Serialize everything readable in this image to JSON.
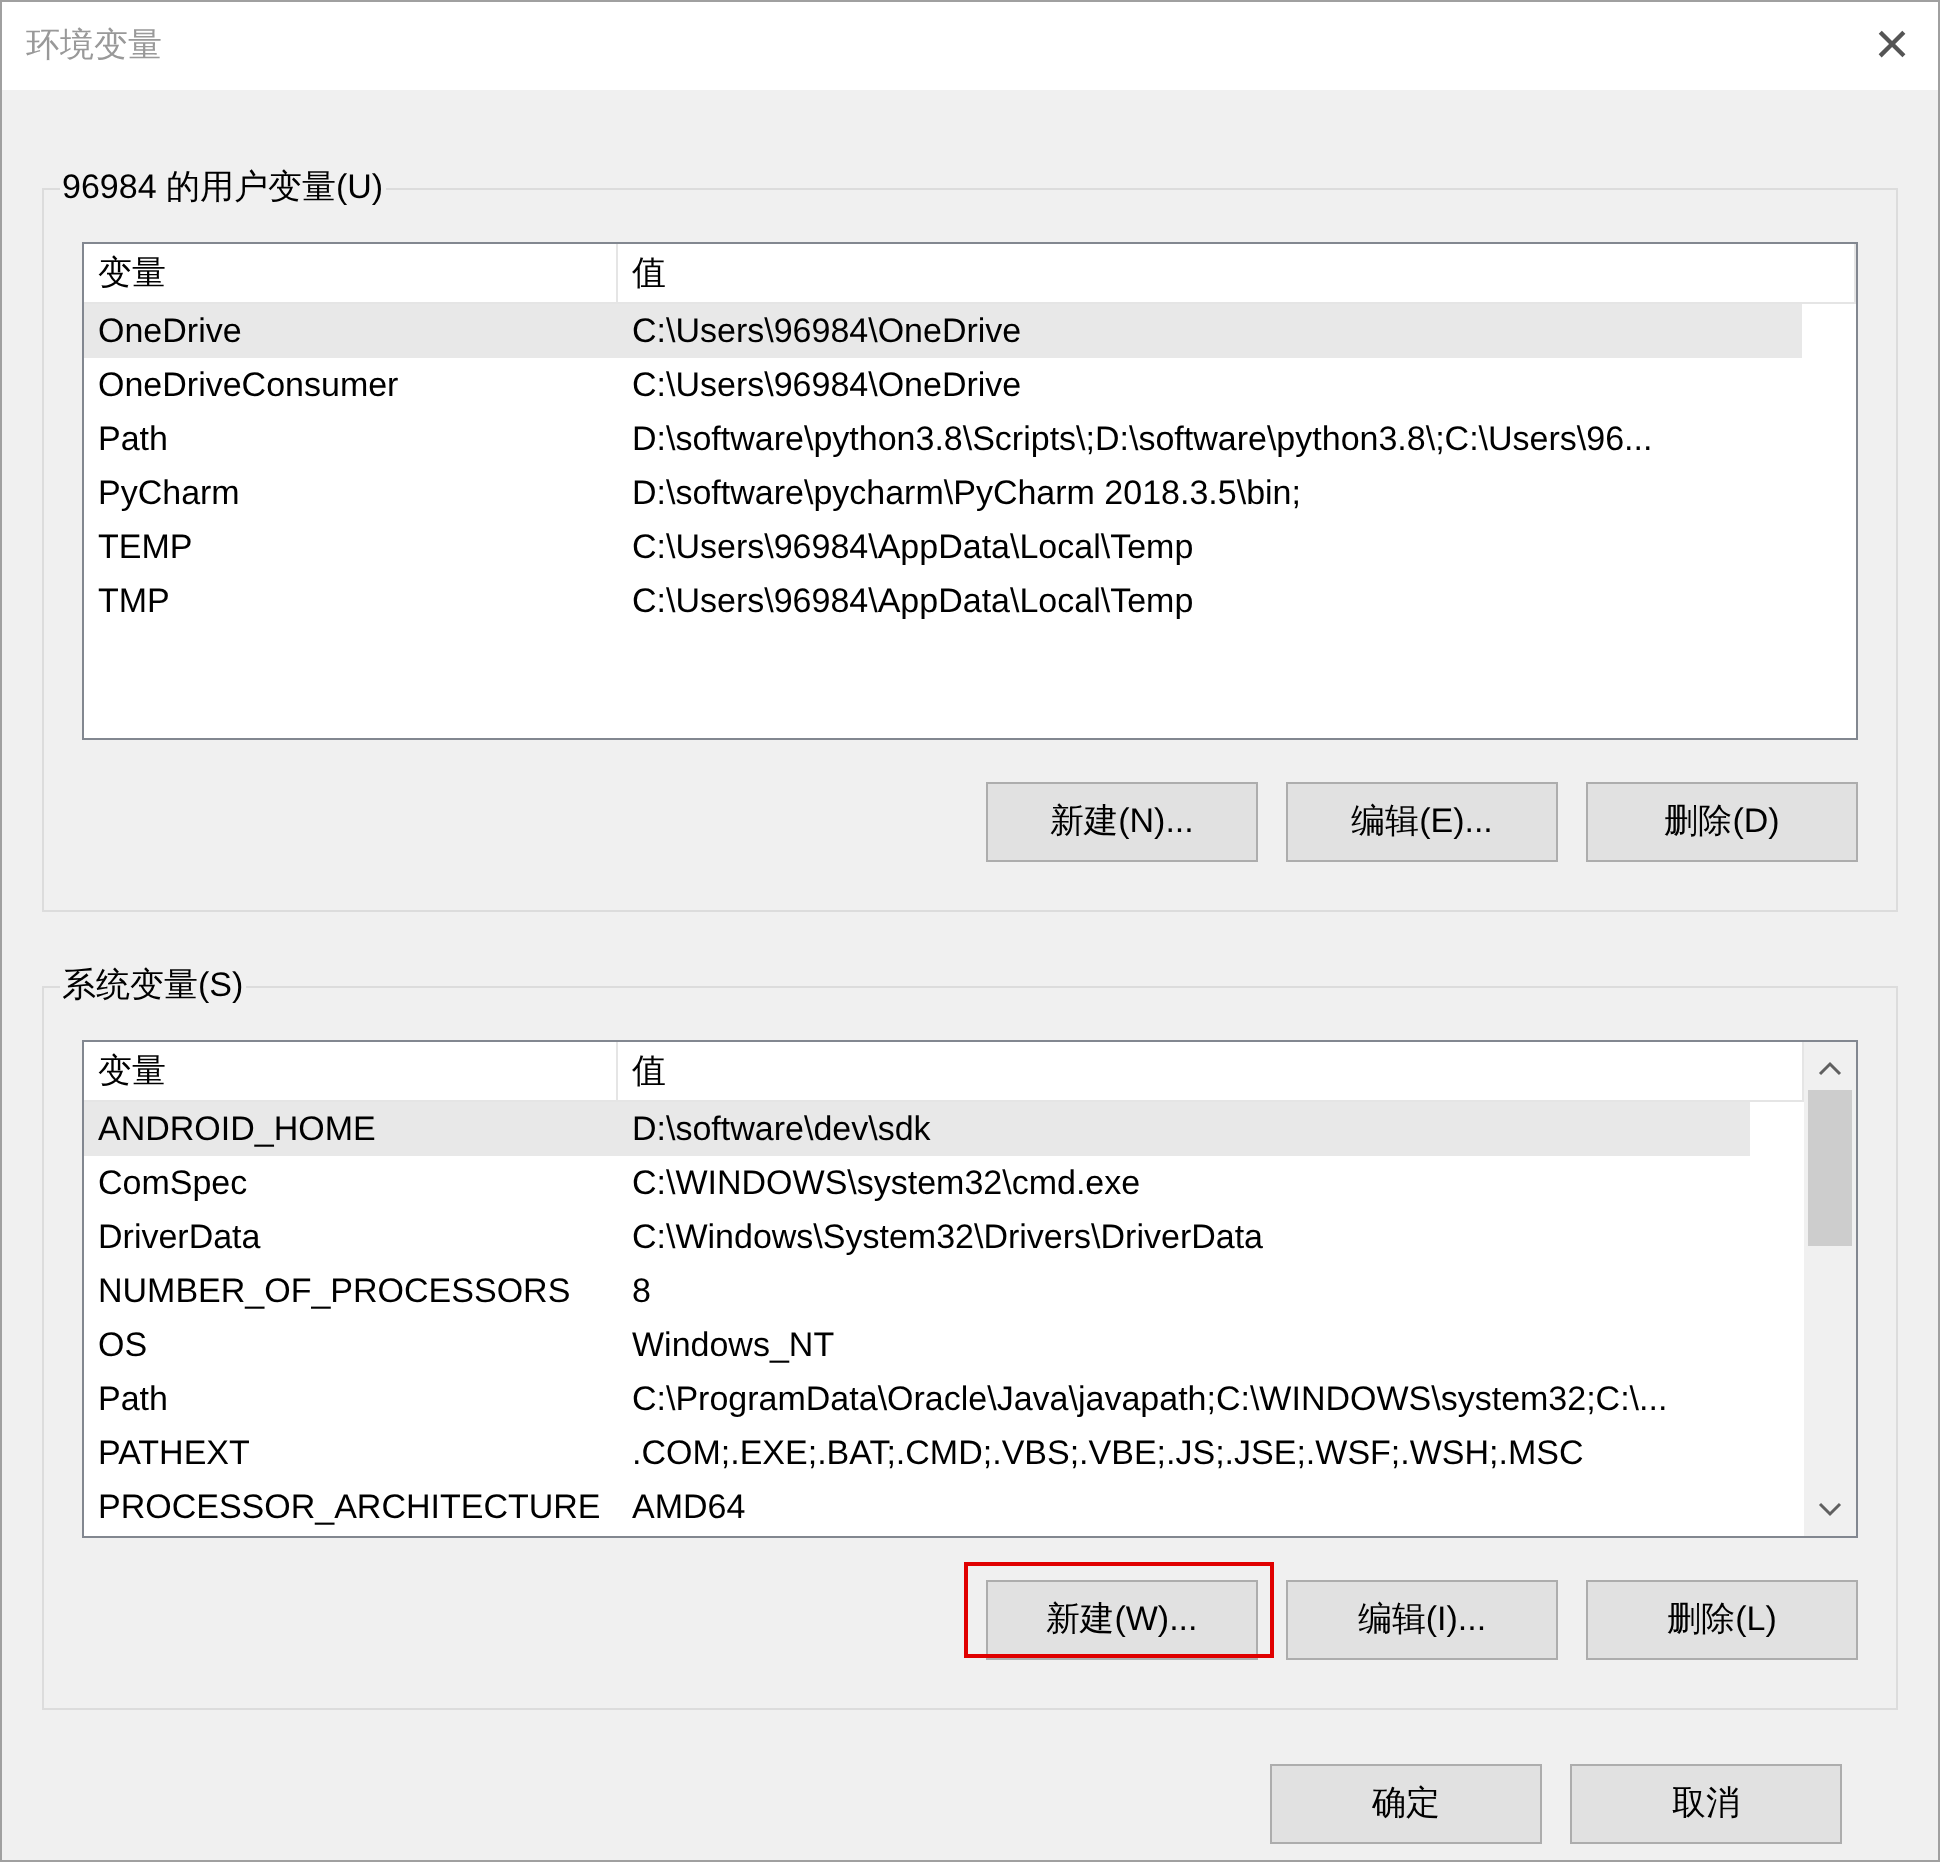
{
  "window": {
    "title": "环境变量",
    "close": "×"
  },
  "groups": [
    {
      "title": "96984 的用户变量(U)",
      "columns": [
        "变量",
        "值"
      ],
      "scrollbar": false,
      "rows": [
        {
          "cells": [
            "OneDrive",
            "C:\\Users\\96984\\OneDrive"
          ],
          "selected": true
        },
        {
          "cells": [
            "OneDriveConsumer",
            "C:\\Users\\96984\\OneDrive"
          ],
          "selected": false
        },
        {
          "cells": [
            "Path",
            "D:\\software\\python3.8\\Scripts\\;D:\\software\\python3.8\\;C:\\Users\\96..."
          ],
          "selected": false
        },
        {
          "cells": [
            "PyCharm",
            "D:\\software\\pycharm\\PyCharm 2018.3.5\\bin;"
          ],
          "selected": false
        },
        {
          "cells": [
            "TEMP",
            "C:\\Users\\96984\\AppData\\Local\\Temp"
          ],
          "selected": false
        },
        {
          "cells": [
            "TMP",
            "C:\\Users\\96984\\AppData\\Local\\Temp"
          ],
          "selected": false
        }
      ],
      "buttons": [
        {
          "label": "新建(N)...",
          "highlighted": false
        },
        {
          "label": "编辑(E)...",
          "highlighted": false
        },
        {
          "label": "删除(D)",
          "highlighted": false
        }
      ]
    },
    {
      "title": "系统变量(S)",
      "columns": [
        "变量",
        "值"
      ],
      "scrollbar": true,
      "rows": [
        {
          "cells": [
            "ANDROID_HOME",
            "D:\\software\\dev\\sdk"
          ],
          "selected": true
        },
        {
          "cells": [
            "ComSpec",
            "C:\\WINDOWS\\system32\\cmd.exe"
          ],
          "selected": false
        },
        {
          "cells": [
            "DriverData",
            "C:\\Windows\\System32\\Drivers\\DriverData"
          ],
          "selected": false
        },
        {
          "cells": [
            "NUMBER_OF_PROCESSORS",
            "8"
          ],
          "selected": false
        },
        {
          "cells": [
            "OS",
            "Windows_NT"
          ],
          "selected": false
        },
        {
          "cells": [
            "Path",
            "C:\\ProgramData\\Oracle\\Java\\javapath;C:\\WINDOWS\\system32;C:\\..."
          ],
          "selected": false
        },
        {
          "cells": [
            "PATHEXT",
            ".COM;.EXE;.BAT;.CMD;.VBS;.VBE;.JS;.JSE;.WSF;.WSH;.MSC"
          ],
          "selected": false
        },
        {
          "cells": [
            "PROCESSOR_ARCHITECTURE",
            "AMD64"
          ],
          "selected": false
        }
      ],
      "buttons": [
        {
          "label": "新建(W)...",
          "highlighted": true
        },
        {
          "label": "编辑(I)...",
          "highlighted": false
        },
        {
          "label": "删除(L)",
          "highlighted": false
        }
      ]
    }
  ],
  "footer_buttons": [
    "确定",
    "取消"
  ]
}
